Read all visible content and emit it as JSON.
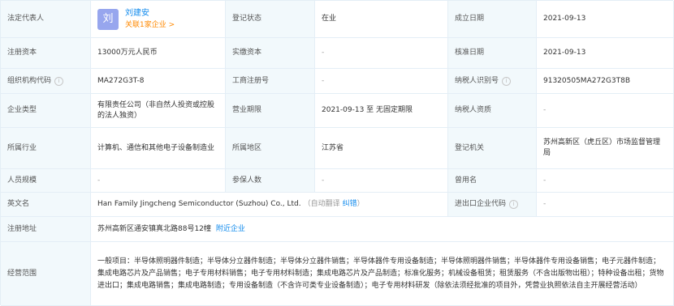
{
  "rows": {
    "legal_rep": {
      "label": "法定代表人",
      "avatar_char": "刘",
      "name": "刘建安",
      "related": "关联1家企业 >",
      "status_label": "登记状态",
      "status_value": "在业",
      "founded_label": "成立日期",
      "founded_value": "2021-09-13"
    },
    "capital": {
      "label": "注册资本",
      "value": "13000万元人民币",
      "paid_label": "实缴资本",
      "paid_value": "-",
      "approved_label": "核准日期",
      "approved_value": "2021-09-13"
    },
    "org_code": {
      "label": "组织机构代码",
      "value": "MA272G3T-8",
      "reg_no_label": "工商注册号",
      "reg_no_value": "-",
      "taxpayer_id_label": "纳税人识别号",
      "taxpayer_id_value": "91320505MA272G3T8B"
    },
    "company_type": {
      "label": "企业类型",
      "value": "有限责任公司（非自然人投资或控股的法人独资）",
      "term_label": "营业期限",
      "term_value": "2021-09-13 至 无固定期限",
      "qualification_label": "纳税人资质",
      "qualification_value": "-"
    },
    "industry": {
      "label": "所属行业",
      "value": "计算机、通信和其他电子设备制造业",
      "region_label": "所属地区",
      "region_value": "江苏省",
      "authority_label": "登记机关",
      "authority_value": "苏州高新区（虎丘区）市场监督管理局"
    },
    "staff": {
      "label": "人员规模",
      "value": "-",
      "insured_label": "参保人数",
      "insured_value": "-",
      "former_name_label": "曾用名",
      "former_name_value": "-"
    },
    "english": {
      "label": "英文名",
      "value": "Han Family Jingcheng Semiconductor (Suzhou) Co., Ltd.",
      "auto_translate": "（自动翻译",
      "correct_link": "纠错",
      "close_paren": "）",
      "ie_code_label": "进出口企业代码",
      "ie_code_value": "-"
    },
    "address": {
      "label": "注册地址",
      "value": "苏州高新区通安镇真北路88号12幢",
      "nearby_link": "附近企业"
    },
    "scope": {
      "label": "经营范围",
      "value": "一般项目：半导体照明器件制造；半导体分立器件制造；半导体分立器件销售；半导体器件专用设备制造；半导体照明器件销售；半导体器件专用设备销售；电子元器件制造；集成电路芯片及产品销售；电子专用材料销售；电子专用材料制造；集成电路芯片及产品制造；标准化服务；机械设备租赁；租赁服务（不含出版物出租）；特种设备出租；货物进出口；集成电路销售；集成电路制造；专用设备制造（不含许可类专业设备制造）；电子专用材料研发（除依法须经批准的项目外，凭营业执照依法自主开展经营活动）"
    }
  },
  "info_icon_glyph": "i",
  "colors": {
    "label_bg": "#f2f9fc",
    "border": "#e4eef6",
    "link": "#128bed",
    "orange": "#ff8900",
    "avatar": "#97a6ee"
  }
}
